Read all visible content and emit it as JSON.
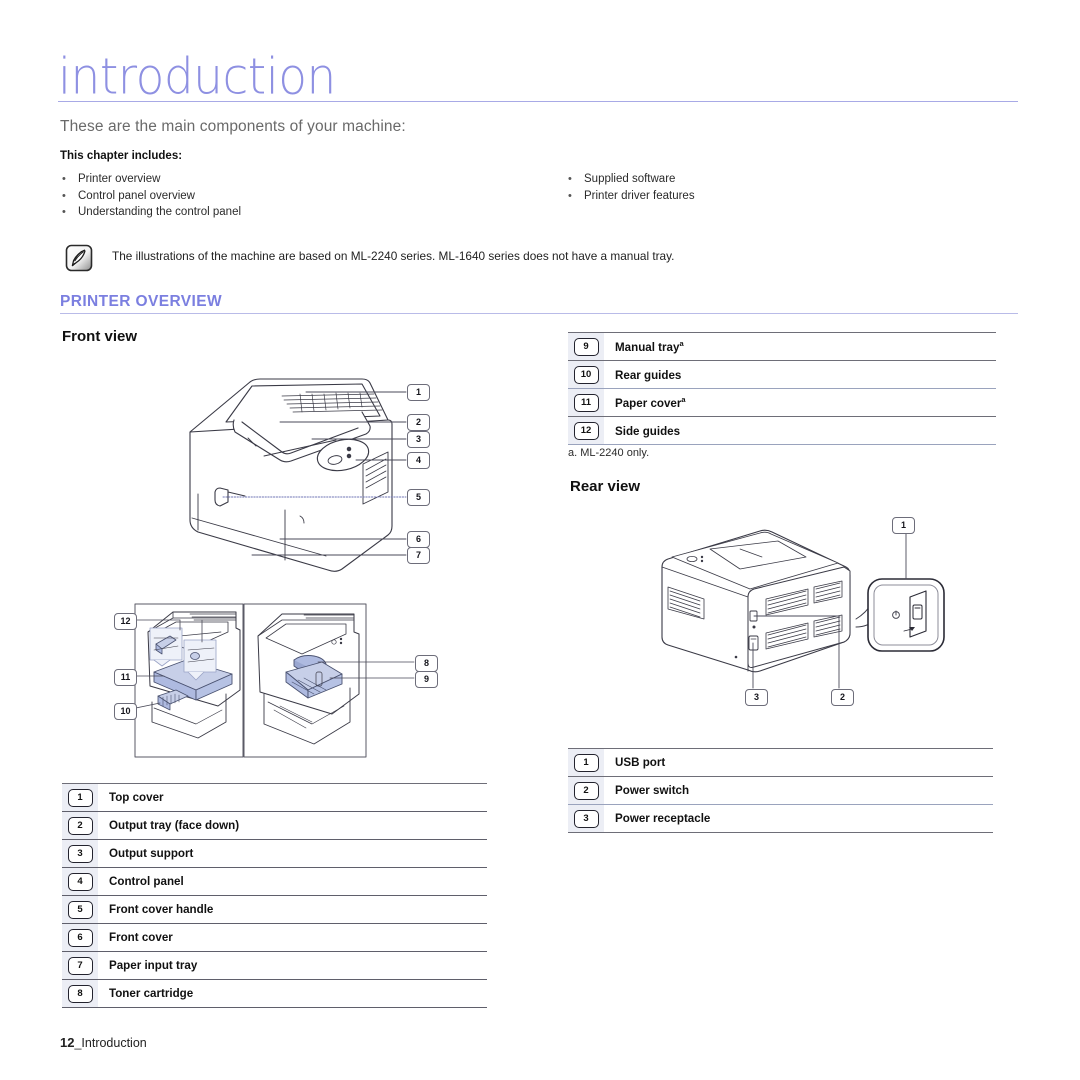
{
  "document": {
    "chapter_title": "introduction",
    "subtitle": "These are the main components of your machine:",
    "includes_label": "This chapter includes:",
    "includes_left": [
      "Printer overview",
      "Control panel overview",
      "Understanding the control panel"
    ],
    "includes_right": [
      "Supplied software",
      "Printer driver features"
    ],
    "bullet": "•"
  },
  "note": {
    "icon": "note-pen-icon",
    "text": "The illustrations of the machine are based on ML-2240 series. ML-1640 series does not have a manual tray."
  },
  "section": {
    "heading": "PRINTER OVERVIEW",
    "front_view_heading": "Front view",
    "rear_view_heading": "Rear view"
  },
  "front_legend": [
    {
      "num": "1",
      "label": "Top cover"
    },
    {
      "num": "2",
      "label": "Output tray (face down)"
    },
    {
      "num": "3",
      "label": "Output support"
    },
    {
      "num": "4",
      "label": "Control panel"
    },
    {
      "num": "5",
      "label": "Front cover handle"
    },
    {
      "num": "6",
      "label": "Front cover"
    },
    {
      "num": "7",
      "label": "Paper input tray"
    },
    {
      "num": "8",
      "label": "Toner cartridge"
    }
  ],
  "front_legend_right": [
    {
      "num": "9",
      "label": "Manual tray",
      "footnote_mark": "a"
    },
    {
      "num": "10",
      "label": "Rear guides",
      "footnote_mark": ""
    },
    {
      "num": "11",
      "label": "Paper cover",
      "footnote_mark": "a"
    },
    {
      "num": "12",
      "label": "Side guides",
      "footnote_mark": ""
    }
  ],
  "footnote": "a. ML-2240 only.",
  "rear_legend": [
    {
      "num": "1",
      "label": "USB port"
    },
    {
      "num": "2",
      "label": "Power switch"
    },
    {
      "num": "3",
      "label": "Power receptacle"
    }
  ],
  "front_figure_callouts": [
    "1",
    "2",
    "3",
    "4",
    "5",
    "6",
    "7"
  ],
  "front_detail_callouts": [
    "12",
    "11",
    "10",
    "8",
    "9"
  ],
  "rear_figure_callouts": [
    "1",
    "3",
    "2"
  ],
  "footer": {
    "page_number": "12",
    "separator": "_",
    "chapter": "Introduction"
  },
  "colors": {
    "title": "#8e90e2",
    "section_heading": "#7b7fe0",
    "rule": "#b9bbe8",
    "body_text": "#1b1b1b",
    "figure_accent": "#9aa7d6",
    "num_cell_bg": "#eceef5"
  }
}
